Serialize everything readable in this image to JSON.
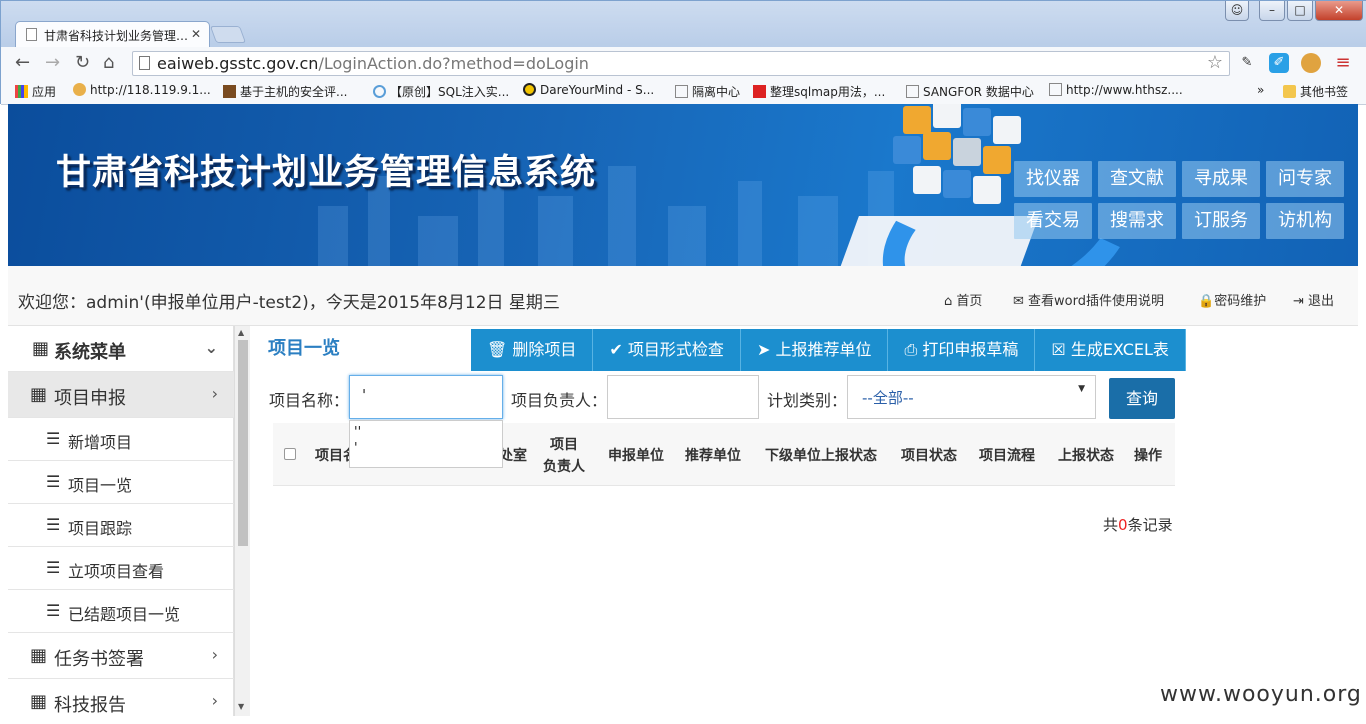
{
  "browser": {
    "tab_title": "甘肃省科技计划业务管理…",
    "url_host": "eaiweb.gsstc.gov.cn",
    "url_path": "/LoginAction.do?method=doLogin",
    "window_controls": {
      "min": "–",
      "max": "□",
      "close": "✕"
    },
    "nav": {
      "back": "←",
      "forward": "→",
      "reload": "↻",
      "home": "⌂"
    },
    "bookmarks": [
      {
        "label": "应用",
        "icon": "apps-grid-icon"
      },
      {
        "label": "http://118.119.9.1...",
        "icon": "page-icon"
      },
      {
        "label": "基于主机的安全评...",
        "icon": "book-icon"
      },
      {
        "label": "【原创】SQL注入实...",
        "icon": "gear-icon"
      },
      {
        "label": "DareYourMind - S...",
        "icon": "radioactive-icon"
      },
      {
        "label": "隔离中心",
        "icon": "page-icon"
      },
      {
        "label": "整理sqlmap用法，...",
        "icon": "c-logo-icon"
      },
      {
        "label": "SANGFOR 数据中心",
        "icon": "page-icon"
      },
      {
        "label": "http://www.hthsz....",
        "icon": "page-icon"
      }
    ],
    "bookmarks_more": "»",
    "other_bookmarks": "其他书签"
  },
  "banner": {
    "title": "甘肃省科技计划业务管理信息系统",
    "quick_links_row1": [
      "找仪器",
      "查文献",
      "寻成果",
      "问专家"
    ],
    "quick_links_row2": [
      "看交易",
      "搜需求",
      "订服务",
      "访机构"
    ]
  },
  "userbar": {
    "welcome": "欢迎您：admin'(申报单位用户-test2)，今天是2015年8月12日 星期三",
    "links": [
      {
        "label": "首页",
        "icon": "home-icon"
      },
      {
        "label": "查看word插件使用说明",
        "icon": "envelope-icon"
      },
      {
        "label": "密码维护",
        "icon": "lock-icon"
      },
      {
        "label": "退出",
        "icon": "sign-out-icon"
      }
    ]
  },
  "sidebar": {
    "header": "系统菜单",
    "items": [
      {
        "label": "项目申报",
        "type": "group",
        "active": true
      },
      {
        "label": "新增项目",
        "type": "sub"
      },
      {
        "label": "项目一览",
        "type": "sub"
      },
      {
        "label": "项目跟踪",
        "type": "sub"
      },
      {
        "label": "立项项目查看",
        "type": "sub"
      },
      {
        "label": "已结题项目一览",
        "type": "sub"
      },
      {
        "label": "任务书签署",
        "type": "group"
      },
      {
        "label": "科技报告",
        "type": "group"
      }
    ]
  },
  "main": {
    "page_title": "项目一览",
    "actions": [
      {
        "label": "删除项目",
        "icon": "trash-icon",
        "glyph": "🗑"
      },
      {
        "label": "项目形式检查",
        "icon": "check-icon",
        "glyph": "✔"
      },
      {
        "label": "上报推荐单位",
        "icon": "paper-plane-icon",
        "glyph": "➤"
      },
      {
        "label": "打印申报草稿",
        "icon": "print-icon",
        "glyph": "⎙"
      },
      {
        "label": "生成EXCEL表",
        "icon": "excel-icon",
        "glyph": "☒"
      }
    ],
    "filters": {
      "name_label": "项目名称：",
      "name_value": "'",
      "leader_label": "项目负责人：",
      "leader_value": "",
      "plan_label": "计划类别：",
      "plan_value": "--全部--",
      "query_label": "查询"
    },
    "autocomplete": [
      "''",
      "'"
    ],
    "table_headers": [
      "项目名",
      "处室",
      "项目\n负责人",
      "申报单位",
      "推荐单位",
      "下级单位上报状态",
      "项目状态",
      "项目流程",
      "上报状态",
      "操作"
    ],
    "count": {
      "prefix": "共",
      "value": "0",
      "suffix": "条记录"
    }
  },
  "watermark": "www.wooyun.org",
  "colors": {
    "accent": "#1c8fcf",
    "title_blue": "#2b7fc2",
    "banner": "#1765b6"
  }
}
